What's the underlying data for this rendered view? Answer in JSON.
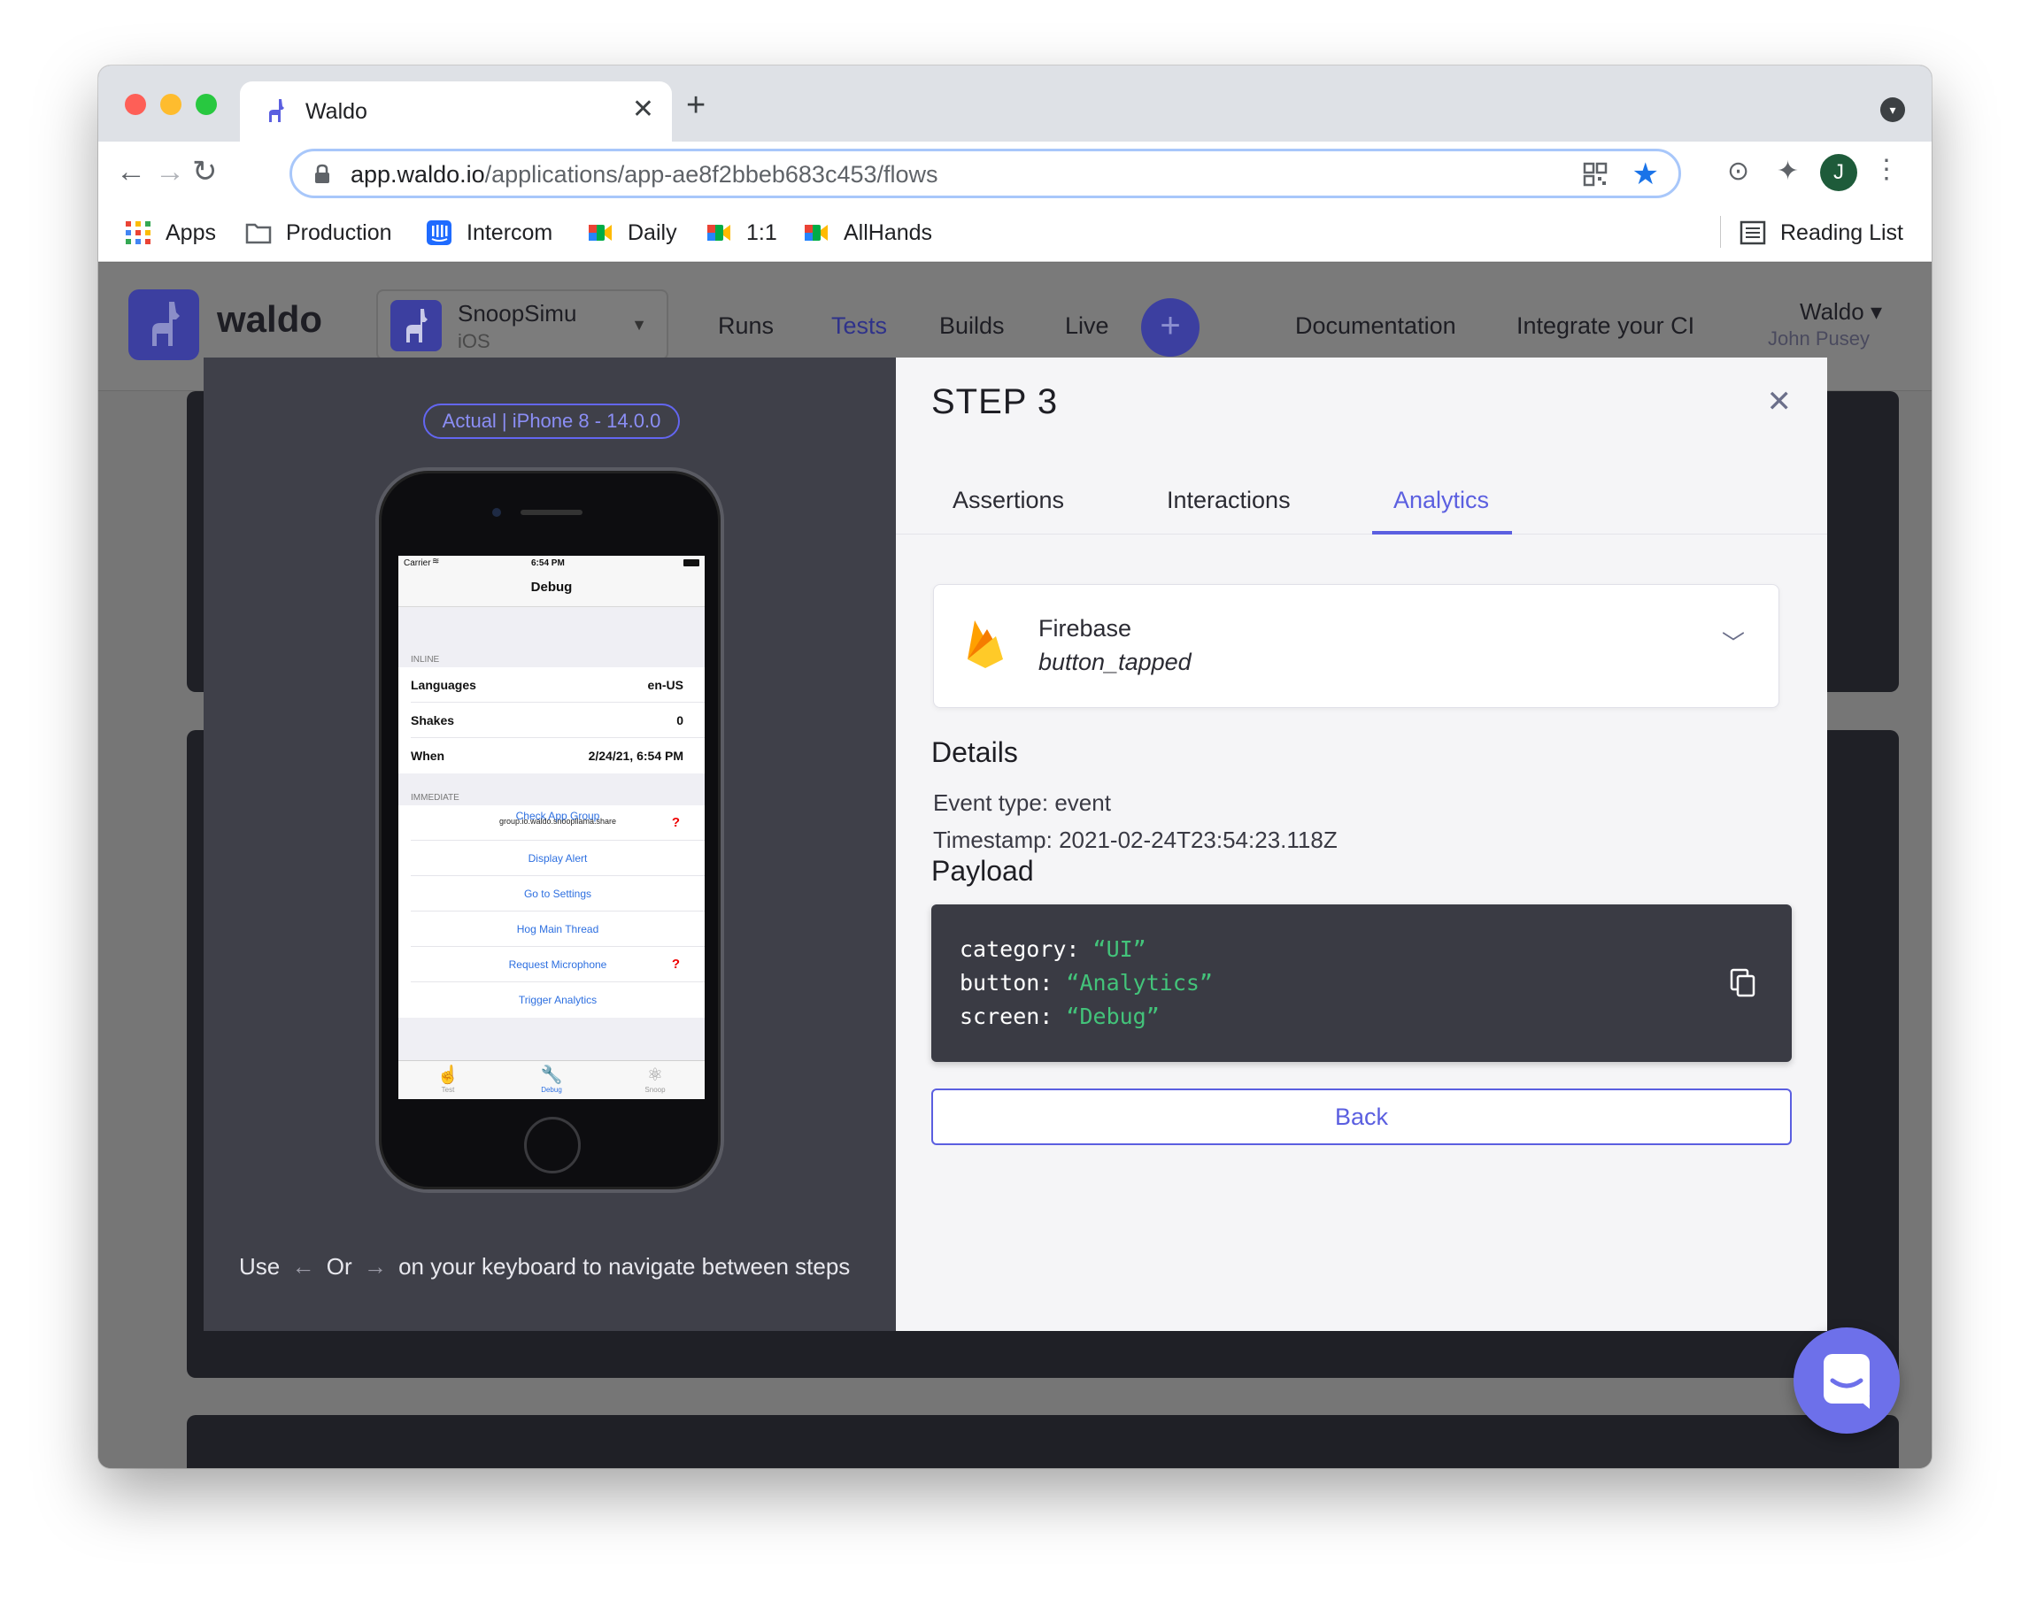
{
  "browser": {
    "tab_title": "Waldo",
    "url_host": "app.waldo.io",
    "url_path": "/applications/app-ae8f2bbeb683c453/flows",
    "profile_initial": "J",
    "bookmarks": [
      {
        "label": "Apps",
        "icon": "apps-grid-icon"
      },
      {
        "label": "Production",
        "icon": "folder-icon"
      },
      {
        "label": "Intercom",
        "icon": "intercom-icon"
      },
      {
        "label": "Daily",
        "icon": "google-meet-icon"
      },
      {
        "label": "1:1",
        "icon": "google-meet-icon"
      },
      {
        "label": "AllHands",
        "icon": "google-meet-icon"
      }
    ],
    "reading_list": "Reading List"
  },
  "app": {
    "logo": "waldo",
    "selected_app": {
      "name": "SnoopSimu",
      "platform": "iOS"
    },
    "nav": [
      "Runs",
      "Tests",
      "Builds",
      "Live"
    ],
    "active_nav": "Tests",
    "links": [
      "Documentation",
      "Integrate your CI"
    ],
    "user": {
      "org": "Waldo",
      "name": "John Pusey"
    }
  },
  "modal": {
    "device_badge": "Actual | iPhone 8 - 14.0.0",
    "phone": {
      "carrier": "Carrier",
      "time": "6:54 PM",
      "title": "Debug",
      "inline_header": "INLINE",
      "inline_rows": [
        {
          "label": "Languages",
          "value": "en-US"
        },
        {
          "label": "Shakes",
          "value": "0"
        },
        {
          "label": "When",
          "value": "2/24/21, 6:54 PM"
        }
      ],
      "immediate_header": "IMMEDIATE",
      "immediate_rows": [
        {
          "label": "Check App Group",
          "sub": "group.io.waldo.snoopllama.share",
          "flag": "?"
        },
        {
          "label": "Display Alert",
          "sub": "",
          "flag": ""
        },
        {
          "label": "Go to Settings",
          "sub": "",
          "flag": ""
        },
        {
          "label": "Hog Main Thread",
          "sub": "",
          "flag": ""
        },
        {
          "label": "Request Microphone",
          "sub": "",
          "flag": "?"
        },
        {
          "label": "Trigger Analytics",
          "sub": "",
          "flag": ""
        }
      ],
      "tabbar": [
        "Test",
        "Debug",
        "Snoop"
      ]
    },
    "hint": {
      "use": "Use",
      "or": "Or",
      "rest": "on your keyboard to navigate between steps"
    },
    "step_title": "STEP 3",
    "tabs": [
      "Assertions",
      "Interactions",
      "Analytics"
    ],
    "active_tab": "Analytics",
    "event": {
      "provider": "Firebase",
      "name": "button_tapped"
    },
    "details_heading": "Details",
    "event_type_label": "Event type:",
    "event_type_value": "event",
    "timestamp_label": "Timestamp:",
    "timestamp_value": "2021-02-24T23:54:23.118Z",
    "payload_heading": "Payload",
    "payload": [
      {
        "key": "category:",
        "value": "“UI”"
      },
      {
        "key": "button:",
        "value": "“Analytics”"
      },
      {
        "key": "screen:",
        "value": "“Debug”"
      }
    ],
    "back_label": "Back"
  },
  "colors": {
    "accent": "#5b5fe0",
    "brand": "#3c3fa0",
    "code_bg": "#3a3b44",
    "code_string": "#43c37a"
  }
}
